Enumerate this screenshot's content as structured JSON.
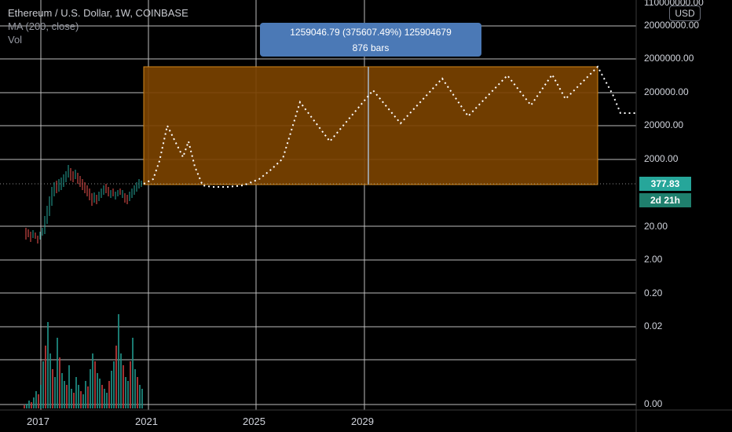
{
  "legend": {
    "symbol": "Ethereum / U.S. Dollar, 1W, COINBASE",
    "ma": "MA (200, close)",
    "vol": "Vol"
  },
  "currency_button": "USD",
  "measure": {
    "line1": "1259046.79 (375607.49%) 125904679",
    "line2": "876 bars"
  },
  "price_label": "377.83",
  "time_label": "2d 21h",
  "y_axis": {
    "ticks": [
      "110000000.00",
      "20000000.00",
      "2000000.00",
      "200000.00",
      "20000.00",
      "2000.00",
      "20.00",
      "2.00",
      "0.20",
      "0.02",
      "0.00"
    ]
  },
  "x_axis": {
    "ticks": [
      "2017",
      "2021",
      "2025",
      "2029"
    ]
  },
  "colors": {
    "background": "#000000",
    "grid": "#bfbfbf",
    "range_fill": "#7a4200",
    "range_border": "#d4881a",
    "up": "#26a69a",
    "down": "#ef5350",
    "projection": "#ffffff",
    "measure": "#4b79b6"
  },
  "chart_data": {
    "type": "line",
    "y_scale": "log",
    "current_price": 377.83,
    "projection_peaks_approx": [
      20000,
      2000000,
      200000,
      2000000,
      200000,
      2000000,
      2000000,
      200000,
      2000000
    ]
  }
}
